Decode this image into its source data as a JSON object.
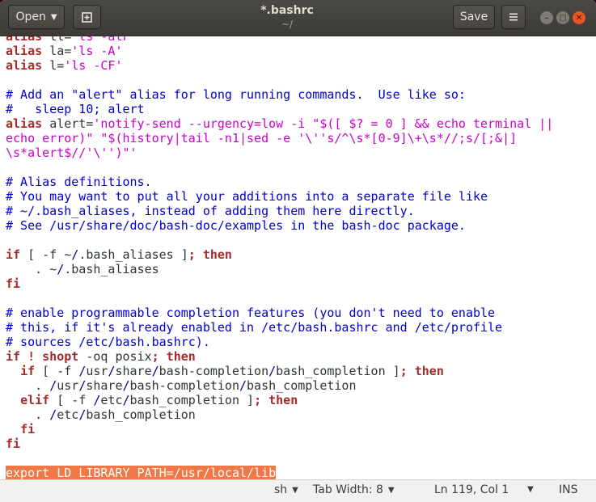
{
  "header": {
    "open_label": "Open",
    "title": "*.bashrc",
    "subtitle": "~/",
    "save_label": "Save"
  },
  "editor": {
    "lines": [
      [
        {
          "t": "alias ",
          "c": "k"
        },
        {
          "t": "ll=",
          "c": ""
        },
        {
          "t": "'ls -alF'",
          "c": "s"
        }
      ],
      [
        {
          "t": "alias ",
          "c": "k"
        },
        {
          "t": "la=",
          "c": ""
        },
        {
          "t": "'ls -A'",
          "c": "s"
        }
      ],
      [
        {
          "t": "alias ",
          "c": "k"
        },
        {
          "t": "l=",
          "c": ""
        },
        {
          "t": "'ls -CF'",
          "c": "s"
        }
      ],
      [],
      [
        {
          "t": "# Add an \"alert\" alias for long running commands.  Use like so:",
          "c": "c"
        }
      ],
      [
        {
          "t": "#   sleep 10; alert",
          "c": "c"
        }
      ],
      [
        {
          "t": "alias ",
          "c": "k"
        },
        {
          "t": "alert=",
          "c": ""
        },
        {
          "t": "'notify-send --urgency=low -i \"$([ $? = 0 ] && echo terminal ||",
          "c": "s"
        }
      ],
      [
        {
          "t": "echo error)\" \"$(history|tail -n1|sed -e '\\''s/^\\s*[0-9]\\+\\s*//;s/[;&|]",
          "c": "s"
        }
      ],
      [
        {
          "t": "\\s*alert$//'\\'')\"'",
          "c": "s"
        }
      ],
      [],
      [
        {
          "t": "# Alias definitions.",
          "c": "c"
        }
      ],
      [
        {
          "t": "# You may want to put all your additions into a separate file like",
          "c": "c"
        }
      ],
      [
        {
          "t": "# ~/.bash_aliases, instead of adding them here directly.",
          "c": "c"
        }
      ],
      [
        {
          "t": "# See /usr/share/doc/bash-doc/examples in the bash-doc package.",
          "c": "c"
        }
      ],
      [],
      [
        {
          "t": "if",
          "c": "k"
        },
        {
          "t": " [ -f ~",
          "c": ""
        },
        {
          "t": "/",
          "c": "p"
        },
        {
          "t": ".bash_aliases ]",
          "c": ""
        },
        {
          "t": "; ",
          "c": "k"
        },
        {
          "t": "then",
          "c": "k"
        }
      ],
      [
        {
          "t": "    . ~",
          "c": ""
        },
        {
          "t": "/",
          "c": "p"
        },
        {
          "t": ".bash_aliases",
          "c": ""
        }
      ],
      [
        {
          "t": "fi",
          "c": "k"
        }
      ],
      [],
      [
        {
          "t": "# enable programmable completion features (you don't need to enable",
          "c": "c"
        }
      ],
      [
        {
          "t": "# this, if it's already enabled in /etc/bash.bashrc and /etc/profile",
          "c": "c"
        }
      ],
      [
        {
          "t": "# sources /etc/bash.bashrc).",
          "c": "c"
        }
      ],
      [
        {
          "t": "if ! shopt",
          "c": "k"
        },
        {
          "t": " -oq posix",
          "c": ""
        },
        {
          "t": "; then",
          "c": "k"
        }
      ],
      [
        {
          "t": "  ",
          "c": ""
        },
        {
          "t": "if",
          "c": "k"
        },
        {
          "t": " [ -f ",
          "c": ""
        },
        {
          "t": "/",
          "c": "p"
        },
        {
          "t": "usr",
          "c": ""
        },
        {
          "t": "/",
          "c": "p"
        },
        {
          "t": "share",
          "c": ""
        },
        {
          "t": "/",
          "c": "p"
        },
        {
          "t": "bash-completion",
          "c": ""
        },
        {
          "t": "/",
          "c": "p"
        },
        {
          "t": "bash_completion ]",
          "c": ""
        },
        {
          "t": "; then",
          "c": "k"
        }
      ],
      [
        {
          "t": "    . ",
          "c": ""
        },
        {
          "t": "/",
          "c": "p"
        },
        {
          "t": "usr",
          "c": ""
        },
        {
          "t": "/",
          "c": "p"
        },
        {
          "t": "share",
          "c": ""
        },
        {
          "t": "/",
          "c": "p"
        },
        {
          "t": "bash-completion",
          "c": ""
        },
        {
          "t": "/",
          "c": "p"
        },
        {
          "t": "bash_completion",
          "c": ""
        }
      ],
      [
        {
          "t": "  ",
          "c": ""
        },
        {
          "t": "elif",
          "c": "k"
        },
        {
          "t": " [ -f ",
          "c": ""
        },
        {
          "t": "/",
          "c": "p"
        },
        {
          "t": "etc",
          "c": ""
        },
        {
          "t": "/",
          "c": "p"
        },
        {
          "t": "bash_completion ]",
          "c": ""
        },
        {
          "t": "; then",
          "c": "k"
        }
      ],
      [
        {
          "t": "    . ",
          "c": ""
        },
        {
          "t": "/",
          "c": "p"
        },
        {
          "t": "etc",
          "c": ""
        },
        {
          "t": "/",
          "c": "p"
        },
        {
          "t": "bash_completion",
          "c": ""
        }
      ],
      [
        {
          "t": "  ",
          "c": ""
        },
        {
          "t": "fi",
          "c": "k"
        }
      ],
      [
        {
          "t": "fi",
          "c": "k"
        }
      ],
      [],
      [
        {
          "t": "export LD_LIBRARY_PATH=/usr/local/lib",
          "c": "sel"
        }
      ]
    ]
  },
  "statusbar": {
    "language": "sh",
    "tab_width": "Tab Width: 8",
    "position": "Ln 119, Col 1",
    "mode": "INS"
  },
  "colors": {
    "comment": "#0000cc",
    "keyword": "#a52a2a",
    "string": "#cc00cc",
    "selection": "#f07746",
    "close_button": "#e95420"
  }
}
